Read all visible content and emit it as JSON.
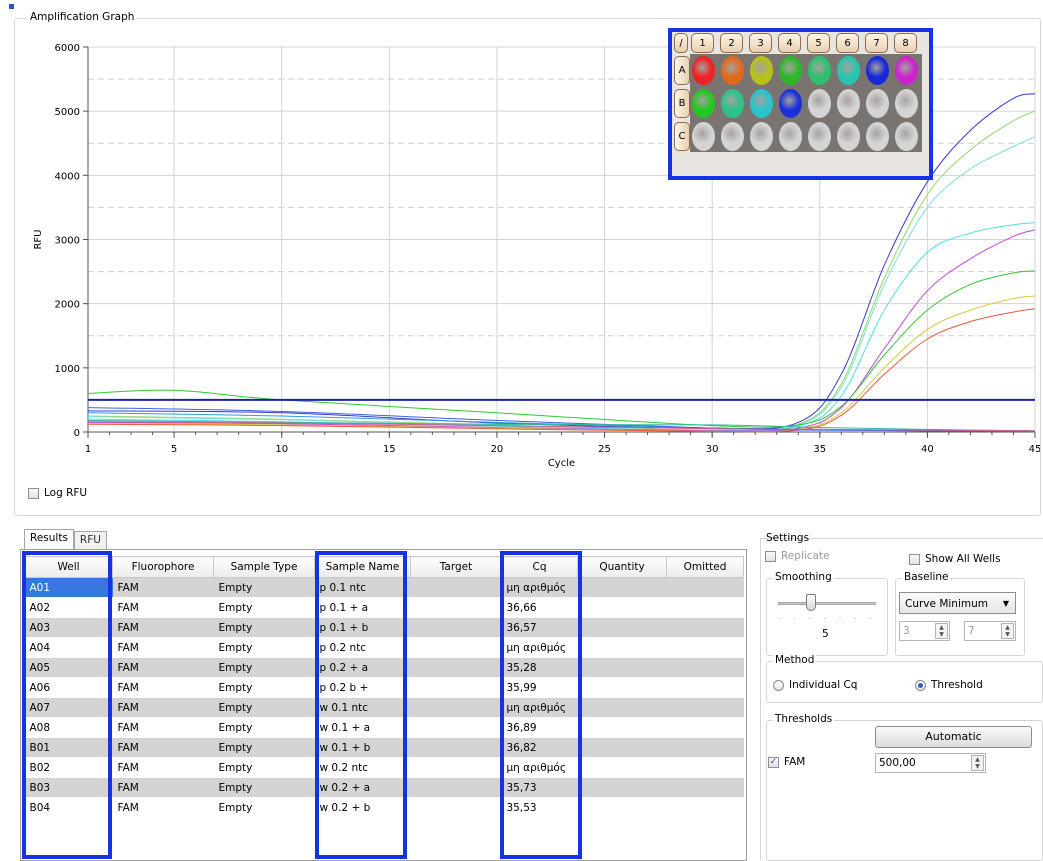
{
  "graph": {
    "title": "Amplification Graph",
    "log_rfu_label": "Log RFU",
    "log_rfu_checked": false
  },
  "plate": {
    "corner": "/",
    "columns": [
      "1",
      "2",
      "3",
      "4",
      "5",
      "6",
      "7",
      "8"
    ],
    "rows": [
      "A",
      "B",
      "C"
    ],
    "well_colors": [
      [
        "#ee2222",
        "#e06a1c",
        "#b8c01a",
        "#2ab82a",
        "#2ec06c",
        "#28c4b0",
        "#1628d8",
        "#cc22cc"
      ],
      [
        "#22c822",
        "#28c48c",
        "#28c4cc",
        "#1a30d8",
        "#d4d4d4",
        "#d4d4d4",
        "#d4d4d4",
        "#d4d4d4"
      ],
      [
        "#d4d4d4",
        "#d4d4d4",
        "#d4d4d4",
        "#d4d4d4",
        "#d4d4d4",
        "#d4d4d4",
        "#d4d4d4",
        "#d4d4d4"
      ]
    ]
  },
  "chart_data": {
    "type": "line",
    "xlabel": "Cycle",
    "ylabel": "RFU",
    "xlim": [
      1,
      45
    ],
    "ylim": [
      0,
      6000
    ],
    "x_ticks": [
      1,
      5,
      10,
      15,
      20,
      25,
      30,
      35,
      40,
      45
    ],
    "y_ticks": [
      0,
      1000,
      2000,
      3000,
      4000,
      5000,
      6000
    ],
    "grid": true,
    "threshold": 500,
    "series": [
      {
        "color": "#3a3ad6",
        "points": [
          [
            1,
            330
          ],
          [
            10,
            300
          ],
          [
            20,
            140
          ],
          [
            30,
            60
          ],
          [
            34,
            150
          ],
          [
            36,
            900
          ],
          [
            38,
            2600
          ],
          [
            40,
            3900
          ],
          [
            42,
            4700
          ],
          [
            44,
            5200
          ],
          [
            45,
            5270
          ]
        ]
      },
      {
        "color": "#8fd86a",
        "points": [
          [
            1,
            250
          ],
          [
            10,
            200
          ],
          [
            20,
            110
          ],
          [
            30,
            30
          ],
          [
            34,
            120
          ],
          [
            36,
            750
          ],
          [
            38,
            2400
          ],
          [
            40,
            3700
          ],
          [
            42,
            4400
          ],
          [
            44,
            4850
          ],
          [
            45,
            5000
          ]
        ]
      },
      {
        "color": "#7fdede",
        "points": [
          [
            1,
            240
          ],
          [
            10,
            190
          ],
          [
            20,
            100
          ],
          [
            30,
            30
          ],
          [
            34,
            110
          ],
          [
            36,
            700
          ],
          [
            38,
            2300
          ],
          [
            40,
            3500
          ],
          [
            42,
            4100
          ],
          [
            44,
            4450
          ],
          [
            45,
            4600
          ]
        ]
      },
      {
        "color": "#4fe0e0",
        "points": [
          [
            1,
            200
          ],
          [
            10,
            160
          ],
          [
            20,
            90
          ],
          [
            30,
            20
          ],
          [
            34,
            90
          ],
          [
            36,
            560
          ],
          [
            38,
            1900
          ],
          [
            40,
            2800
          ],
          [
            42,
            3100
          ],
          [
            44,
            3230
          ],
          [
            45,
            3260
          ]
        ]
      },
      {
        "color": "#c04ad8",
        "points": [
          [
            1,
            150
          ],
          [
            10,
            130
          ],
          [
            20,
            70
          ],
          [
            30,
            20
          ],
          [
            34,
            60
          ],
          [
            36,
            380
          ],
          [
            38,
            1300
          ],
          [
            40,
            2200
          ],
          [
            42,
            2700
          ],
          [
            44,
            3050
          ],
          [
            45,
            3150
          ]
        ]
      },
      {
        "color": "#2ecc2e",
        "points": [
          [
            1,
            600
          ],
          [
            5,
            650
          ],
          [
            10,
            500
          ],
          [
            20,
            300
          ],
          [
            30,
            100
          ],
          [
            34,
            110
          ],
          [
            36,
            400
          ],
          [
            38,
            1200
          ],
          [
            40,
            1900
          ],
          [
            42,
            2300
          ],
          [
            44,
            2480
          ],
          [
            45,
            2510
          ]
        ]
      },
      {
        "color": "#d8cc3a",
        "points": [
          [
            1,
            130
          ],
          [
            10,
            110
          ],
          [
            20,
            60
          ],
          [
            30,
            10
          ],
          [
            34,
            40
          ],
          [
            36,
            300
          ],
          [
            38,
            1000
          ],
          [
            40,
            1600
          ],
          [
            42,
            1900
          ],
          [
            44,
            2080
          ],
          [
            45,
            2120
          ]
        ]
      },
      {
        "color": "#ee5a3a",
        "points": [
          [
            1,
            120
          ],
          [
            10,
            100
          ],
          [
            20,
            50
          ],
          [
            30,
            10
          ],
          [
            34,
            30
          ],
          [
            36,
            260
          ],
          [
            38,
            900
          ],
          [
            40,
            1450
          ],
          [
            42,
            1720
          ],
          [
            44,
            1870
          ],
          [
            45,
            1920
          ]
        ]
      },
      {
        "color": "#2aa0e0",
        "points": [
          [
            1,
            300
          ],
          [
            10,
            250
          ],
          [
            20,
            150
          ],
          [
            30,
            60
          ],
          [
            35,
            40
          ],
          [
            40,
            20
          ],
          [
            45,
            10
          ]
        ]
      },
      {
        "color": "#4060e8",
        "points": [
          [
            1,
            380
          ],
          [
            10,
            320
          ],
          [
            20,
            180
          ],
          [
            30,
            60
          ],
          [
            35,
            30
          ],
          [
            40,
            15
          ],
          [
            45,
            10
          ]
        ]
      },
      {
        "color": "#30b8a0",
        "points": [
          [
            1,
            180
          ],
          [
            10,
            150
          ],
          [
            20,
            120
          ],
          [
            30,
            110
          ],
          [
            35,
            70
          ],
          [
            40,
            40
          ],
          [
            45,
            20
          ]
        ]
      },
      {
        "color": "#d06090",
        "points": [
          [
            1,
            160
          ],
          [
            10,
            140
          ],
          [
            20,
            100
          ],
          [
            30,
            50
          ],
          [
            35,
            40
          ],
          [
            40,
            30
          ],
          [
            45,
            20
          ]
        ]
      }
    ]
  },
  "tabs": [
    "Results",
    "RFU"
  ],
  "table": {
    "columns": [
      "Well",
      "Fluorophore",
      "Sample Type",
      "Sample Name",
      "Target",
      "Cq",
      "Quantity",
      "Omitted"
    ],
    "rows": [
      [
        "A01",
        "FAM",
        "Empty",
        "p 0.1 ntc",
        "",
        "μη αριθμός",
        "",
        ""
      ],
      [
        "A02",
        "FAM",
        "Empty",
        "p 0.1 + a",
        "",
        "36,66",
        "",
        ""
      ],
      [
        "A03",
        "FAM",
        "Empty",
        "p 0.1 + b",
        "",
        "36,57",
        "",
        ""
      ],
      [
        "A04",
        "FAM",
        "Empty",
        "p 0.2 ntc",
        "",
        "μη αριθμός",
        "",
        ""
      ],
      [
        "A05",
        "FAM",
        "Empty",
        "p 0.2 + a",
        "",
        "35,28",
        "",
        ""
      ],
      [
        "A06",
        "FAM",
        "Empty",
        "p 0.2 b +",
        "",
        "35,99",
        "",
        ""
      ],
      [
        "A07",
        "FAM",
        "Empty",
        "w 0.1 ntc",
        "",
        "μη αριθμός",
        "",
        ""
      ],
      [
        "A08",
        "FAM",
        "Empty",
        "w 0.1 + a",
        "",
        "36,89",
        "",
        ""
      ],
      [
        "B01",
        "FAM",
        "Empty",
        "w 0.1 + b",
        "",
        "36,82",
        "",
        ""
      ],
      [
        "B02",
        "FAM",
        "Empty",
        "w 0.2 ntc",
        "",
        "μη αριθμός",
        "",
        ""
      ],
      [
        "B03",
        "FAM",
        "Empty",
        "w 0.2 + a",
        "",
        "35,73",
        "",
        ""
      ],
      [
        "B04",
        "FAM",
        "Empty",
        "w 0.2 + b",
        "",
        "35,53",
        "",
        ""
      ]
    ]
  },
  "settings": {
    "title": "Settings",
    "replicate_label": "Replicate",
    "show_all_wells_label": "Show All Wells",
    "smoothing": {
      "title": "Smoothing",
      "value": "5"
    },
    "baseline": {
      "title": "Baseline",
      "selected": "Curve Minimum",
      "from": "3",
      "to": "7"
    },
    "method": {
      "title": "Method",
      "individual_label": "Individual Cq",
      "threshold_label": "Threshold",
      "selected": "Threshold"
    },
    "thresholds": {
      "title": "Thresholds",
      "automatic_label": "Automatic",
      "fluor_label": "FAM",
      "fluor_checked": true,
      "value": "500,00"
    }
  }
}
